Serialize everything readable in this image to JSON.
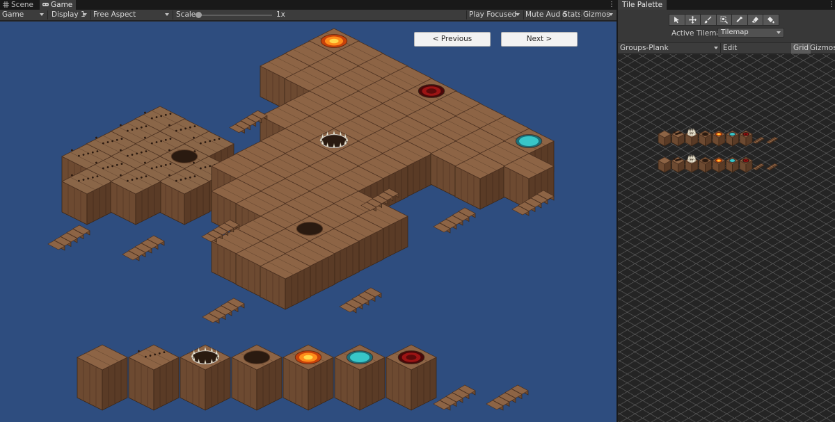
{
  "scene_view": {
    "tabs": [
      {
        "label": "Scene",
        "icon": "grid-icon",
        "active": false
      },
      {
        "label": "Game",
        "icon": "gamepad-icon",
        "active": true
      }
    ],
    "toolbar": {
      "display_mode": "Game",
      "display": "Display 1",
      "aspect": "Free Aspect",
      "scale_label": "Scale",
      "scale_value": "1x",
      "scale_level": 0.0,
      "play_mode": "Play Focused",
      "mute_audio": "Mute Audio",
      "stats": "Stats",
      "gizmos": "Gizmos"
    },
    "game": {
      "previous_label": "< Previous",
      "next_label": "Next >",
      "background_color": "#2e4d7f"
    },
    "tile_strip": [
      "plank-crate",
      "rusty-crate",
      "spike-trap",
      "hole",
      "lava-pit",
      "water-pool",
      "blood-pool",
      "stairs-left",
      "stairs-right"
    ]
  },
  "tile_palette": {
    "tab_label": "Tile Palette",
    "tools": [
      "select-icon",
      "move-icon",
      "brush-icon",
      "box-fill-icon",
      "picker-icon",
      "eraser-icon",
      "fill-icon"
    ],
    "active_tilemap_label": "Active Tilemap",
    "active_tilemap_value": "Tilemap",
    "palette_name": "Groups-Plank",
    "edit_label": "Edit",
    "grid_label": "Grid",
    "gizmos_label": "Gizmos"
  },
  "colors": {
    "wood_top": "#8d6445",
    "wood_left": "#6d4a31",
    "wood_right": "#5a3b26",
    "lava": "#ff8c1a",
    "water": "#38c6c8",
    "blood": "#9c1414"
  }
}
